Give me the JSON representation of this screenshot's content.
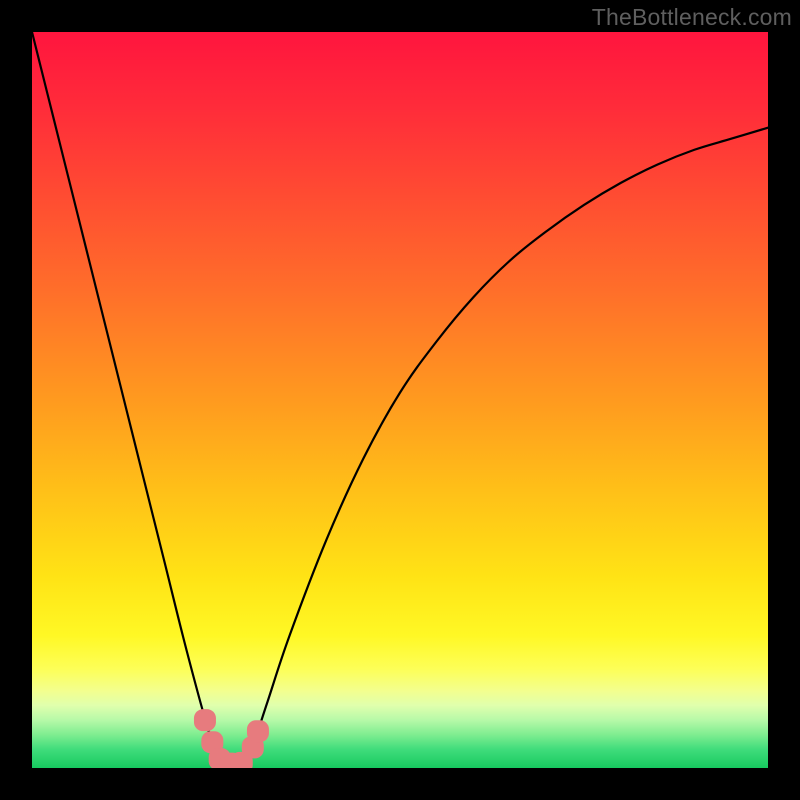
{
  "watermark": "TheBottleneck.com",
  "chart_data": {
    "type": "line",
    "title": "",
    "xlabel": "",
    "ylabel": "",
    "xlim": [
      0,
      100
    ],
    "ylim": [
      0,
      100
    ],
    "series": [
      {
        "name": "bottleneck-curve",
        "x": [
          0,
          3,
          6,
          9,
          12,
          15,
          18,
          21,
          24,
          25.5,
          27,
          28,
          29,
          30,
          32,
          35,
          40,
          45,
          50,
          55,
          60,
          65,
          70,
          75,
          80,
          85,
          90,
          95,
          100
        ],
        "y": [
          100,
          88,
          76,
          64,
          52,
          40,
          28,
          16,
          5,
          1,
          0.5,
          0.5,
          1,
          3,
          9,
          18,
          31,
          42,
          51,
          58,
          64,
          69,
          73,
          76.5,
          79.5,
          82,
          84,
          85.5,
          87
        ]
      }
    ],
    "markers": {
      "name": "highlight-nodes",
      "color": "#e77b7e",
      "points": [
        {
          "x": 23.5,
          "y": 6.5
        },
        {
          "x": 24.5,
          "y": 3.5
        },
        {
          "x": 25.5,
          "y": 1.2
        },
        {
          "x": 27.0,
          "y": 0.6
        },
        {
          "x": 28.5,
          "y": 0.7
        },
        {
          "x": 30.0,
          "y": 2.8
        },
        {
          "x": 30.7,
          "y": 5.0
        }
      ]
    },
    "gradient_stops": [
      {
        "offset": 0.0,
        "color": "#ff153e"
      },
      {
        "offset": 0.1,
        "color": "#ff2b3a"
      },
      {
        "offset": 0.22,
        "color": "#ff4b32"
      },
      {
        "offset": 0.35,
        "color": "#ff6e2a"
      },
      {
        "offset": 0.5,
        "color": "#ff9a1f"
      },
      {
        "offset": 0.62,
        "color": "#ffbf18"
      },
      {
        "offset": 0.74,
        "color": "#ffe315"
      },
      {
        "offset": 0.82,
        "color": "#fff825"
      },
      {
        "offset": 0.865,
        "color": "#fdff57"
      },
      {
        "offset": 0.895,
        "color": "#f3ff8e"
      },
      {
        "offset": 0.915,
        "color": "#e0ffad"
      },
      {
        "offset": 0.935,
        "color": "#b6f9a8"
      },
      {
        "offset": 0.955,
        "color": "#7eed90"
      },
      {
        "offset": 0.975,
        "color": "#3fdc7b"
      },
      {
        "offset": 1.0,
        "color": "#17c95f"
      }
    ]
  }
}
